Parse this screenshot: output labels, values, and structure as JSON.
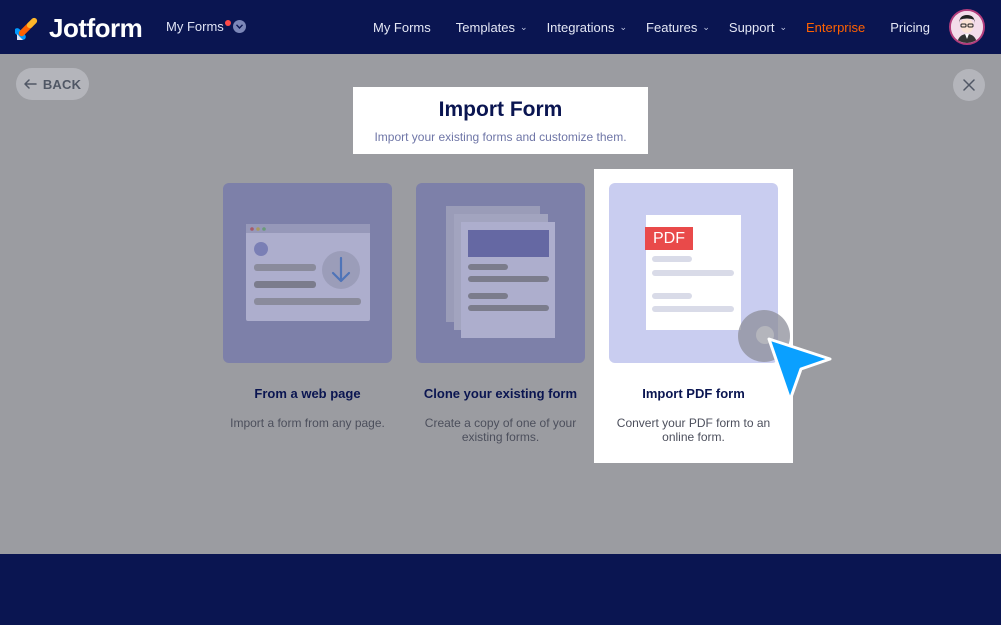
{
  "brand": {
    "name": "Jotform"
  },
  "header_nav": {
    "workspace_switch": "My Forms",
    "items": [
      {
        "label": "My Forms",
        "has_caret": false
      },
      {
        "label": "Templates",
        "has_caret": true
      },
      {
        "label": "Integrations",
        "has_caret": true
      },
      {
        "label": "Features",
        "has_caret": true
      },
      {
        "label": "Support",
        "has_caret": true
      },
      {
        "label": "Enterprise",
        "has_caret": false
      },
      {
        "label": "Pricing",
        "has_caret": false
      }
    ],
    "enterprise_color": "#ff6100"
  },
  "modal": {
    "back_label": "BACK",
    "title": "Import Form",
    "subtitle": "Import your existing forms and customize them.",
    "options": [
      {
        "title": "From a web page",
        "description": "Import a form from any page."
      },
      {
        "title": "Clone your existing form",
        "description": "Create a copy of one of your existing forms."
      },
      {
        "title": "Import PDF form",
        "description": "Convert your PDF form to an online form.",
        "pdf_badge": "PDF"
      }
    ]
  },
  "colors": {
    "nav_bg": "#0a1551",
    "accent_blue": "#09f",
    "pdf_red": "#e94a4a",
    "card_bg": "#c9cdf0"
  }
}
